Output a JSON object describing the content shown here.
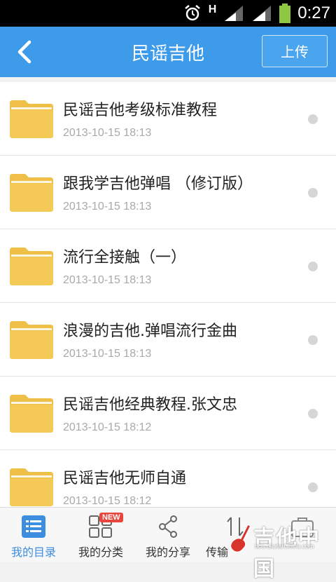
{
  "status_bar": {
    "time": "0:27",
    "network": "H"
  },
  "header": {
    "title": "民谣吉他",
    "upload_label": "上传"
  },
  "list": [
    {
      "title": "民谣吉他考级标准教程",
      "date": "2013-10-15  18:13"
    },
    {
      "title": "跟我学吉他弹唱 （修订版）",
      "date": "2013-10-15  18:13"
    },
    {
      "title": "流行全接触（一）",
      "date": "2013-10-15  18:13"
    },
    {
      "title": "浪漫的吉他.弹唱流行金曲",
      "date": "2013-10-15  18:13"
    },
    {
      "title": "民谣吉他经典教程.张文忠",
      "date": "2013-10-15  18:12"
    },
    {
      "title": "民谣吉他无师自通",
      "date": "2013-10-15  18:12"
    }
  ],
  "tabs": [
    {
      "label": "我的目录",
      "icon": "list-icon",
      "active": true
    },
    {
      "label": "我的分类",
      "icon": "grid-icon",
      "badge": "NEW"
    },
    {
      "label": "我的分享",
      "icon": "share-icon"
    },
    {
      "label": "传输",
      "icon": "transfer-icon"
    }
  ],
  "watermark": {
    "text": "吉他中国",
    "sub": "bbs.GuitarChina.com"
  },
  "colors": {
    "accent": "#3d9be9",
    "folder": "#f5c955",
    "badge": "#e8453c"
  }
}
